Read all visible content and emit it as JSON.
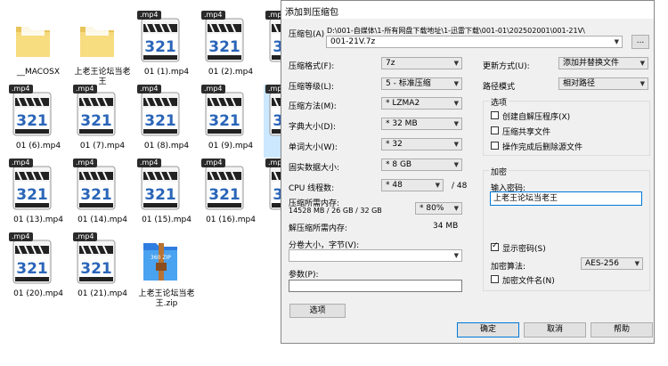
{
  "explorer": {
    "files": [
      {
        "name": "__MACOSX",
        "type": "folder"
      },
      {
        "name": "上老王论坛当老王",
        "type": "folder"
      },
      {
        "name": "01 (1).mp4",
        "type": "mp4",
        "badge": ".mp4"
      },
      {
        "name": "01 (2).mp4",
        "type": "mp4",
        "badge": ".mp4"
      },
      {
        "name": "",
        "type": "mp4",
        "badge": ".mp4"
      },
      {
        "name": "01 (6).mp4",
        "type": "mp4",
        "badge": ".mp4"
      },
      {
        "name": "01 (7).mp4",
        "type": "mp4",
        "badge": ".mp4"
      },
      {
        "name": "01 (8).mp4",
        "type": "mp4",
        "badge": ".mp4"
      },
      {
        "name": "01 (9).mp4",
        "type": "mp4",
        "badge": ".mp4"
      },
      {
        "name": "",
        "type": "mp4",
        "badge": ".mp4"
      },
      {
        "name": "01 (13).mp4",
        "type": "mp4",
        "badge": ".mp4"
      },
      {
        "name": "01 (14).mp4",
        "type": "mp4",
        "badge": ".mp4"
      },
      {
        "name": "01 (15).mp4",
        "type": "mp4",
        "badge": ".mp4"
      },
      {
        "name": "01 (16).mp4",
        "type": "mp4",
        "badge": ".mp4"
      },
      {
        "name": "",
        "type": "mp4",
        "badge": ".mp4"
      },
      {
        "name": "01 (20).mp4",
        "type": "mp4",
        "badge": ".mp4"
      },
      {
        "name": "01 (21).mp4",
        "type": "mp4",
        "badge": ".mp4"
      },
      {
        "name": "上老王论坛当老王.zip",
        "type": "zip",
        "zip_text": "360 ZIP"
      }
    ],
    "mp4_icon_text": "321"
  },
  "dialog": {
    "title": "添加到压缩包",
    "archive_label": "压缩包(A)",
    "archive_path_line": "D:\\001-自媒体\\1-所有网盘下载地址\\1-迅雷下载\\001-01\\202502001\\001-21V\\",
    "archive_name": "001-21V.7z",
    "browse_button": "...",
    "left": {
      "format_label": "压缩格式(F):",
      "format_value": "7z",
      "level_label": "压缩等级(L):",
      "level_value": "5 - 标准压缩",
      "method_label": "压缩方法(M):",
      "method_value": "* LZMA2",
      "dict_label": "字典大小(D):",
      "dict_value": "* 32 MB",
      "word_label": "单词大小(W):",
      "word_value": "* 32",
      "solid_label": "固实数据大小:",
      "solid_value": "* 8 GB",
      "cpu_label": "CPU 线程数:",
      "cpu_value": "* 48",
      "cpu_max": "/ 48",
      "mem_label": "压缩所需内存:",
      "mem_detail": "14528 MB / 26 GB / 32 GB",
      "mem_percent": "* 80%",
      "demem_label": "解压缩所需内存:",
      "demem_value": "34 MB",
      "split_label": "分卷大小，字节(V):",
      "split_value": "",
      "params_label": "参数(P):",
      "params_value": "",
      "options_button": "选项"
    },
    "right": {
      "update_label": "更新方式(U):",
      "update_value": "添加并替换文件",
      "path_label": "路径模式",
      "path_value": "相对路径",
      "options_group": "选项",
      "opt_sfx": "创建自解压程序(X)",
      "opt_sfx_checked": false,
      "opt_shared": "压缩共享文件",
      "opt_shared_checked": false,
      "opt_delete": "操作完成后删除源文件",
      "opt_delete_checked": false,
      "encrypt_group": "加密",
      "password_label": "输入密码:",
      "password_value": "上老王论坛当老王",
      "show_password": "显示密码(S)",
      "show_password_checked": true,
      "enc_method_label": "加密算法:",
      "enc_method_value": "AES-256",
      "encrypt_names": "加密文件名(N)",
      "encrypt_names_checked": false
    },
    "ok_button": "确定",
    "cancel_button": "取消",
    "help_button": "帮助"
  }
}
